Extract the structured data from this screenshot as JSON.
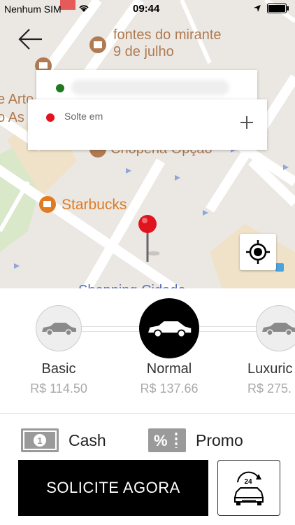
{
  "status_bar": {
    "carrier": "Nenhum SIM",
    "time": "09:44"
  },
  "map": {
    "pois": [
      {
        "name": "fontes do mirante\n9 de julho",
        "line1": "fontes do mirante",
        "line2": "9 de julho"
      },
      {
        "name": "Choperia Opção"
      },
      {
        "name": "Starbucks"
      }
    ],
    "partial_labels": [
      "e Arte",
      "o As",
      "Shopping Cidade"
    ]
  },
  "origin": {
    "address": ""
  },
  "destination": {
    "label": "Solte em"
  },
  "car_options": [
    {
      "name": "Basic",
      "price": "R$ 114.50",
      "selected": false
    },
    {
      "name": "Normal",
      "price": "R$ 137.66",
      "selected": true
    },
    {
      "name": "Luxuric",
      "price": "R$ 275.",
      "selected": false
    }
  ],
  "payment": {
    "cash_label": "Cash",
    "promo_label": "Promo"
  },
  "actions": {
    "request_label": "SOLICITE AGORA"
  },
  "icons": {
    "back": "back-arrow-icon",
    "add": "plus-icon",
    "locate": "crosshair-icon",
    "schedule": "schedule-24-car-icon"
  },
  "colors": {
    "origin_dot": "#1f7a1f",
    "destination_dot": "#e0141e",
    "pin": "#e0141e",
    "poi_starbucks": "#e07b24",
    "button": "#000000"
  }
}
